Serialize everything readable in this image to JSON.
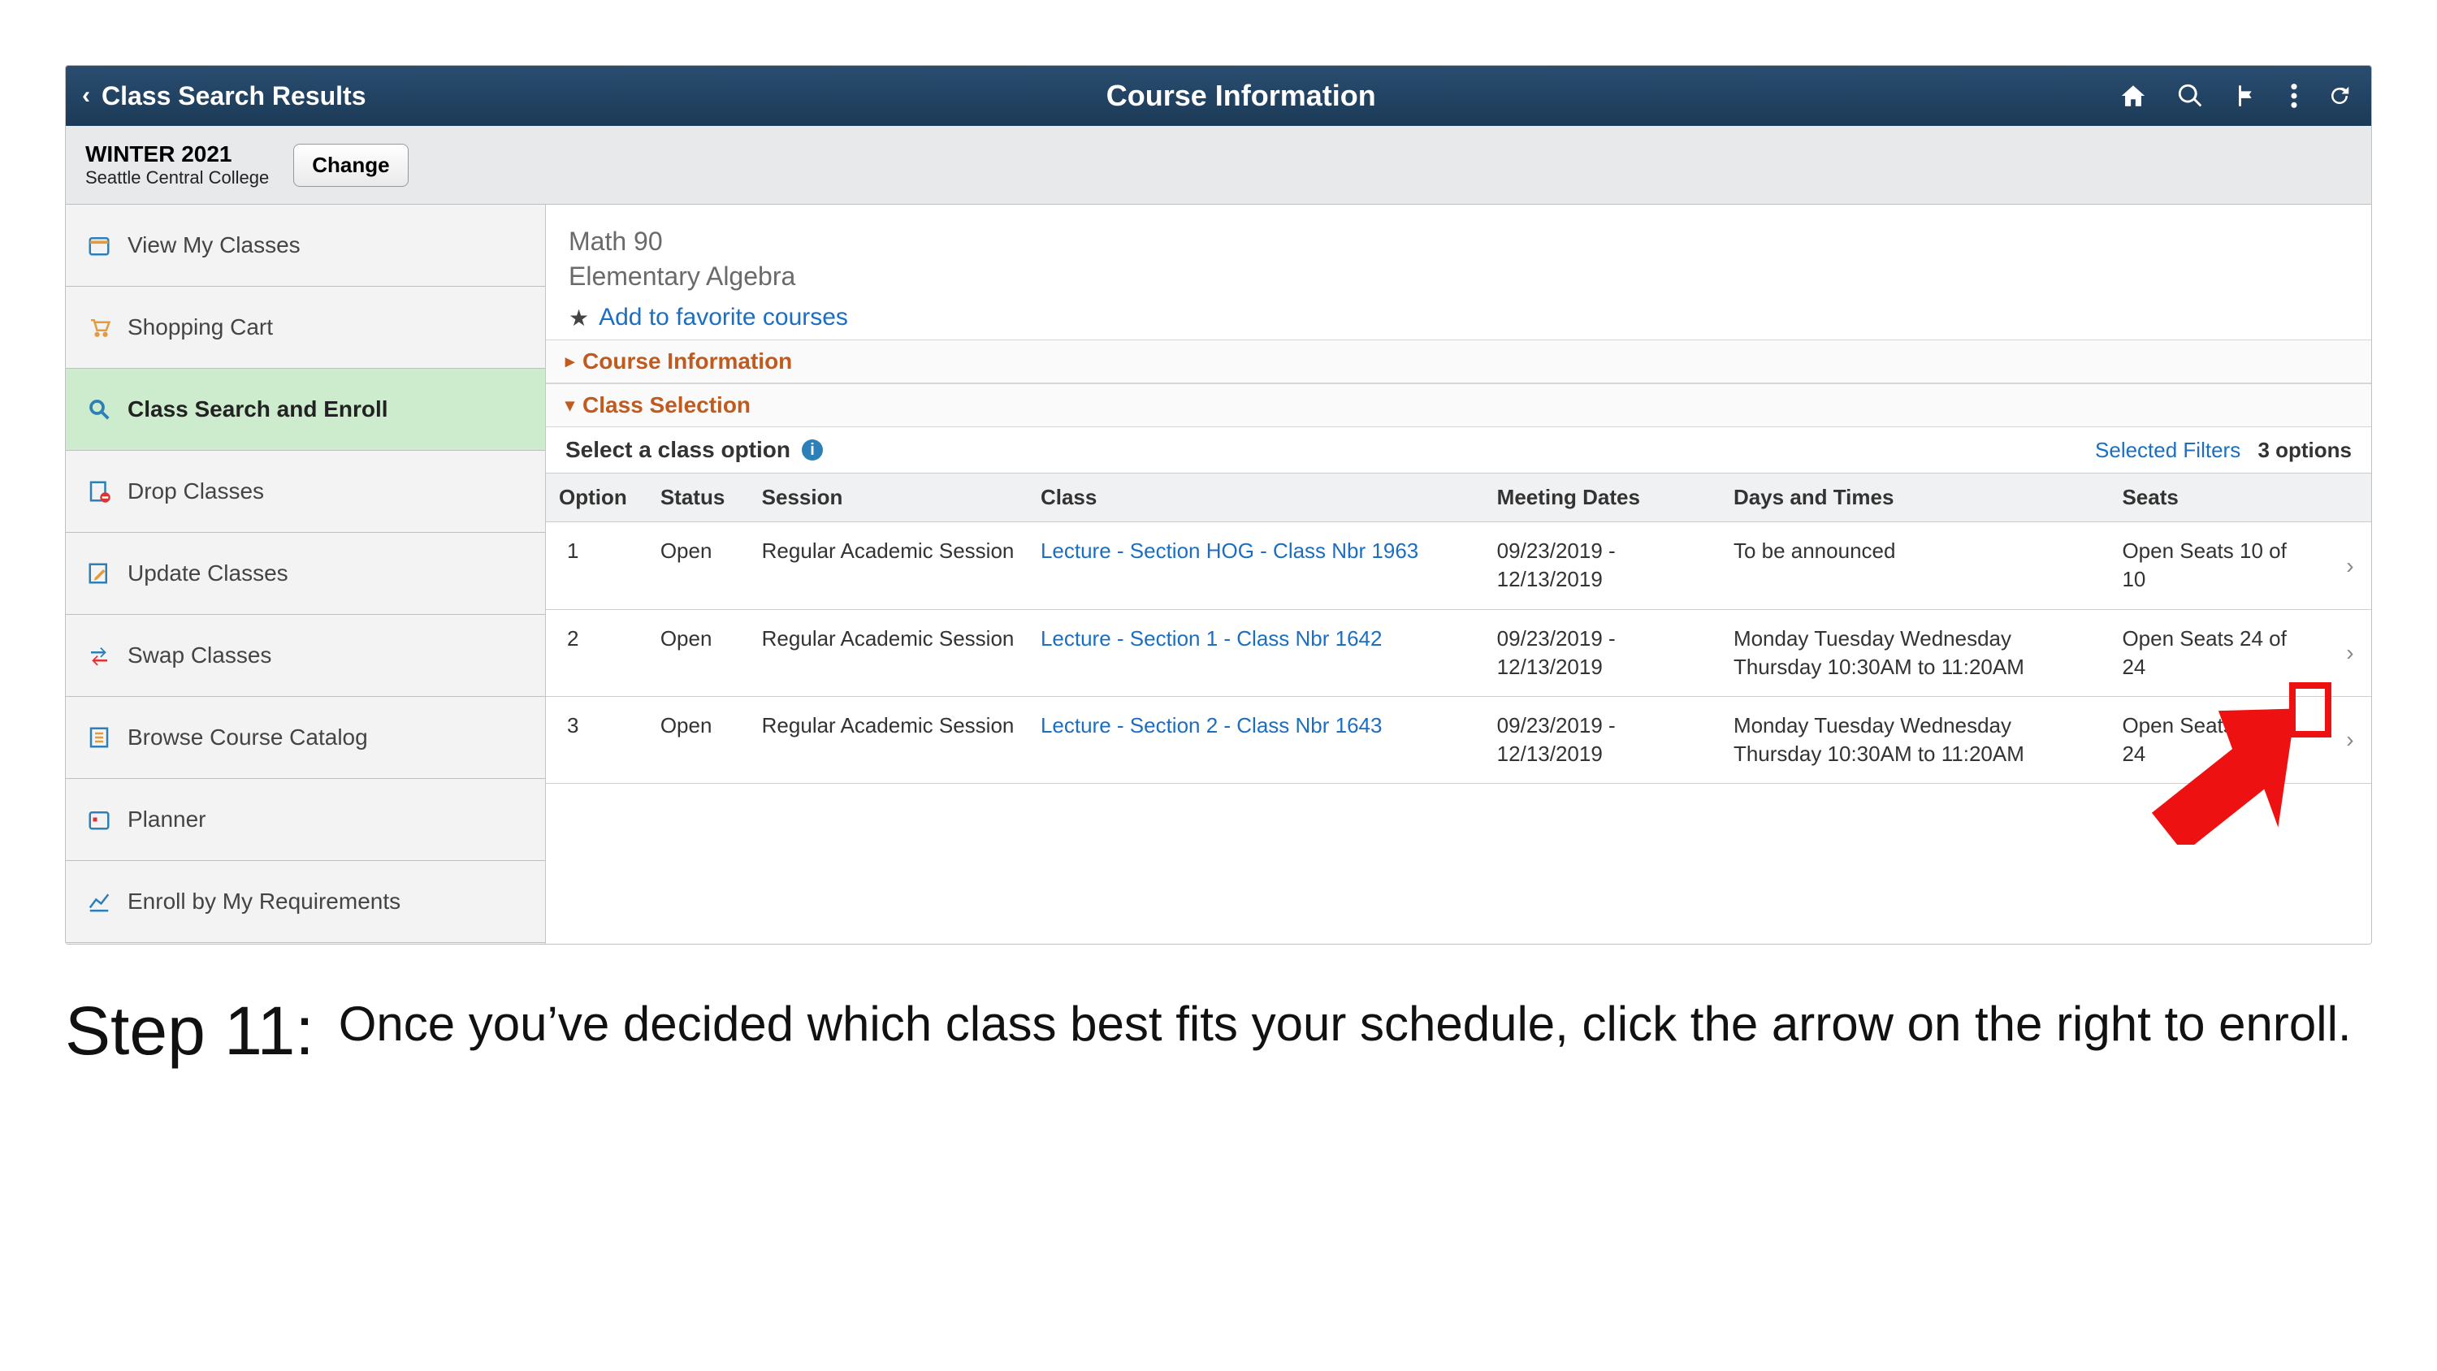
{
  "header": {
    "back_label": "Class Search Results",
    "page_title": "Course Information"
  },
  "term": {
    "term_label": "WINTER 2021",
    "institution": "Seattle Central College",
    "change_label": "Change"
  },
  "sidebar": {
    "items": [
      {
        "label": "View My Classes"
      },
      {
        "label": "Shopping Cart"
      },
      {
        "label": "Class Search and Enroll"
      },
      {
        "label": "Drop Classes"
      },
      {
        "label": "Update Classes"
      },
      {
        "label": "Swap Classes"
      },
      {
        "label": "Browse Course Catalog"
      },
      {
        "label": "Planner"
      },
      {
        "label": "Enroll by My Requirements"
      }
    ],
    "active_index": 2
  },
  "course": {
    "code": "Math 90",
    "title": "Elementary Algebra",
    "add_favorite_label": "Add to favorite courses"
  },
  "sections": {
    "info_label": "Course Information",
    "selection_label": "Class Selection"
  },
  "selection": {
    "instruction": "Select a class option",
    "filters_link": "Selected Filters",
    "options_count": "3 options"
  },
  "table": {
    "headers": {
      "option": "Option",
      "status": "Status",
      "session": "Session",
      "class": "Class",
      "dates": "Meeting Dates",
      "times": "Days and Times",
      "seats": "Seats"
    },
    "rows": [
      {
        "option": "1",
        "status": "Open",
        "session": "Regular Academic Session",
        "class": "Lecture - Section HOG - Class Nbr 1963",
        "dates": "09/23/2019 - 12/13/2019",
        "times": "To be announced",
        "seats": "Open Seats 10 of 10"
      },
      {
        "option": "2",
        "status": "Open",
        "session": "Regular Academic Session",
        "class": "Lecture - Section 1 - Class Nbr 1642",
        "dates": "09/23/2019 - 12/13/2019",
        "times": "Monday Tuesday Wednesday Thursday\n10:30AM to 11:20AM",
        "seats": "Open Seats 24 of 24"
      },
      {
        "option": "3",
        "status": "Open",
        "session": "Regular Academic Session",
        "class": "Lecture - Section 2 - Class Nbr 1643",
        "dates": "09/23/2019 - 12/13/2019",
        "times": "Monday Tuesday Wednesday Thursday\n10:30AM to 11:20AM",
        "seats": "Open Seats 24 of 24"
      }
    ]
  },
  "step": {
    "label": "Step 11:",
    "text": "Once you’ve decided which class best fits your schedule, click the arrow on the right to enroll."
  }
}
